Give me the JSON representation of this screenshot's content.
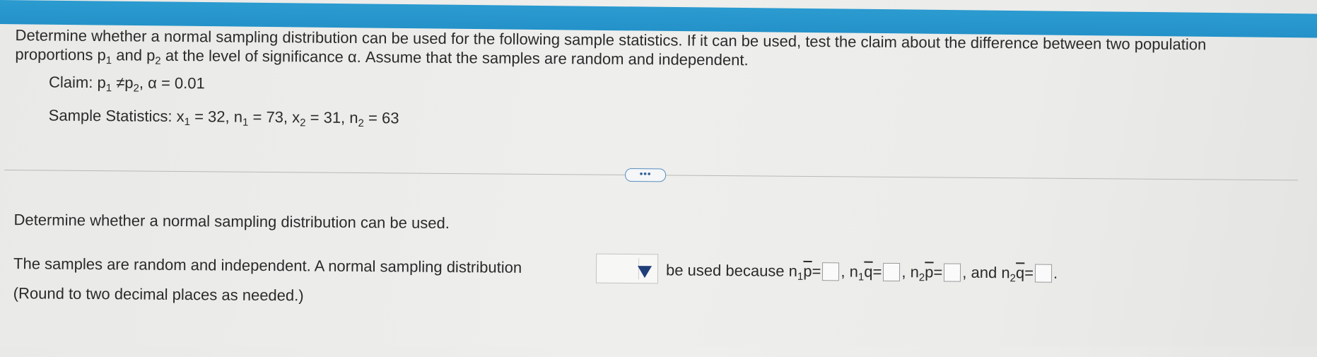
{
  "problem": {
    "instruction": "Determine whether a normal sampling distribution can be used for the following sample statistics. If it can be used, test the claim about the difference between two population proportions",
    "instruction_p1_base": "p",
    "instruction_p1_sub": "1",
    "instruction_and": "and",
    "instruction_p2_base": "p",
    "instruction_p2_sub": "2",
    "instruction_tail": "at the level of significance α. Assume that the samples are random and independent.",
    "claim_label": "Claim:",
    "claim_p1_base": "p",
    "claim_p1_sub": "1",
    "claim_neq": "≠",
    "claim_p2_base": "p",
    "claim_p2_sub": "2",
    "claim_alpha": ", α = 0.01",
    "stats_label": "Sample Statistics:",
    "stats_x1": "x",
    "stats_x1_sub": "1",
    "stats_x1_val": "= 32,",
    "stats_n1": "n",
    "stats_n1_sub": "1",
    "stats_n1_val": "= 73,",
    "stats_x2": "x",
    "stats_x2_sub": "2",
    "stats_x2_val": "= 31,",
    "stats_n2": "n",
    "stats_n2_sub": "2",
    "stats_n2_val": "= 63"
  },
  "more_button": {
    "label": "•••"
  },
  "question": {
    "text": "Determine whether a normal sampling distribution can be used."
  },
  "answer": {
    "left_text": "The samples are random and independent. A normal sampling distribution",
    "dropdown_value": "",
    "right_text": "be used because",
    "n1p_label": "n",
    "n1p_sub": "1",
    "n1p_var": "p",
    "n1q_label": "n",
    "n1q_sub": "1",
    "n1q_var": "q",
    "n2p_label": "n",
    "n2p_sub": "2",
    "n2p_var": "p",
    "n2q_label": "n",
    "n2q_sub": "2",
    "n2q_var": "q",
    "and_text": ", and",
    "round_note": "(Round to two decimal places as needed.)"
  },
  "colors": {
    "top_bar": "#2492c9",
    "dropdown_arrow": "#1f3d78",
    "more_button_border": "#5a8fc0"
  }
}
